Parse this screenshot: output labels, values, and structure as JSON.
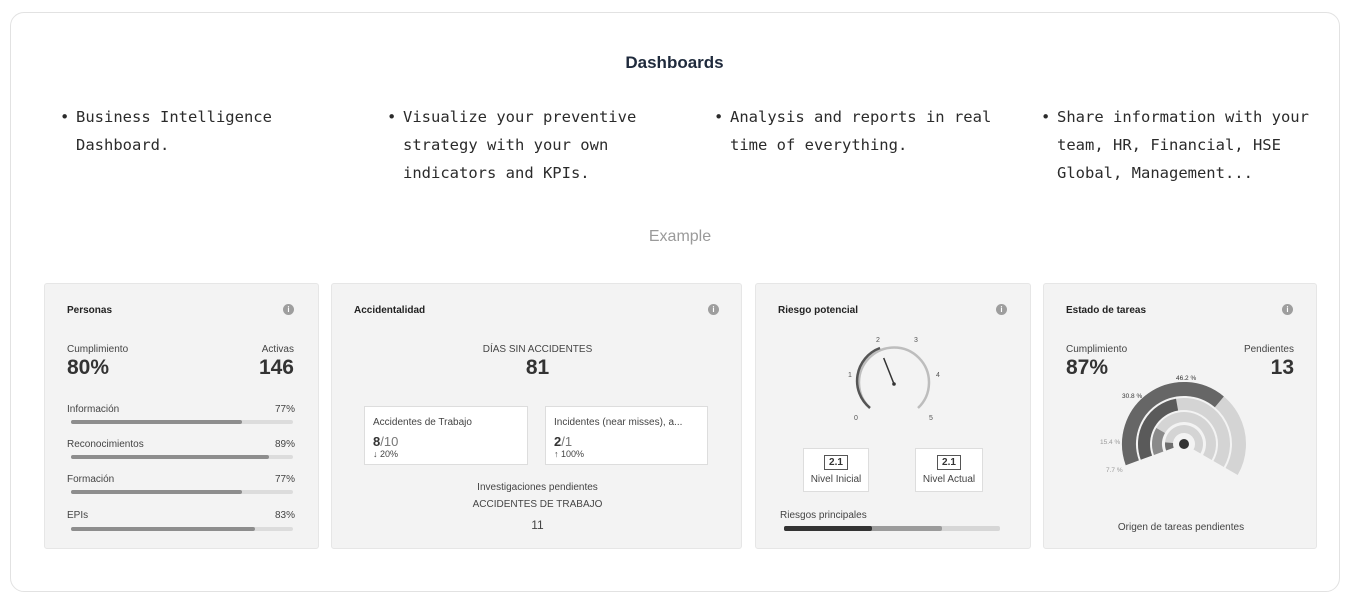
{
  "header": {
    "title": "Dashboards",
    "example_label": "Example"
  },
  "bullets": [
    {
      "lines": [
        "Business Intelligence",
        "Dashboard."
      ]
    },
    {
      "lines": [
        "Visualize your preventive",
        "strategy with your own",
        "indicators and KPIs."
      ]
    },
    {
      "lines": [
        "Analysis and reports in real",
        "time of everything."
      ]
    },
    {
      "lines": [
        "Share information with your",
        "team, HR, Financial, HSE",
        "Global, Management..."
      ]
    }
  ],
  "bullet_glyph": "•",
  "info_glyph": "i",
  "personas": {
    "title": "Personas",
    "cumplimiento_label": "Cumplimiento",
    "cumplimiento_value": "80%",
    "activas_label": "Activas",
    "activas_value": "146",
    "rows": [
      {
        "label": "Información",
        "value": "77%",
        "fraction": 0.77
      },
      {
        "label": "Reconocimientos",
        "value": "89%",
        "fraction": 0.89
      },
      {
        "label": "Formación",
        "value": "77%",
        "fraction": 0.77
      },
      {
        "label": "EPIs",
        "value": "83%",
        "fraction": 0.83
      }
    ]
  },
  "accidentalidad": {
    "title": "Accidentalidad",
    "dias_label": "DÍAS SIN ACCIDENTES",
    "dias_value": "81",
    "box1": {
      "title": "Accidentes de Trabajo",
      "value": "8",
      "total": "/10",
      "delta": "↓ 20%"
    },
    "box2": {
      "title": "Incidentes (near misses), a...",
      "value": "2",
      "total": "/1",
      "delta": "↑ 100%"
    },
    "investigaciones_label": "Investigaciones pendientes",
    "investigaciones_sub": "ACCIDENTES DE TRABAJO",
    "investigaciones_value": "11"
  },
  "riesgo": {
    "title": "Riesgo potencial",
    "gauge_ticks": [
      "0",
      "1",
      "2",
      "3",
      "4",
      "5"
    ],
    "gauge_value": 2.1,
    "nivel_inicial_value": "2.1",
    "nivel_inicial_label": "Nivel Inicial",
    "nivel_actual_value": "2.1",
    "nivel_actual_label": "Nivel Actual",
    "riesgos_label": "Riesgos principales",
    "riesgos_fraction": 0.73
  },
  "tareas": {
    "title": "Estado de tareas",
    "cumplimiento_label": "Cumplimiento",
    "cumplimiento_value": "87%",
    "pendientes_label": "Pendientes",
    "pendientes_value": "13",
    "chart_data": {
      "type": "radial-bar",
      "labels": [
        "46.2 %",
        "30.8 %",
        "15.4 %",
        "7.7 %"
      ],
      "values": [
        46.2,
        30.8,
        15.4,
        7.7
      ]
    },
    "origen_label": "Origen de tareas pendientes"
  }
}
